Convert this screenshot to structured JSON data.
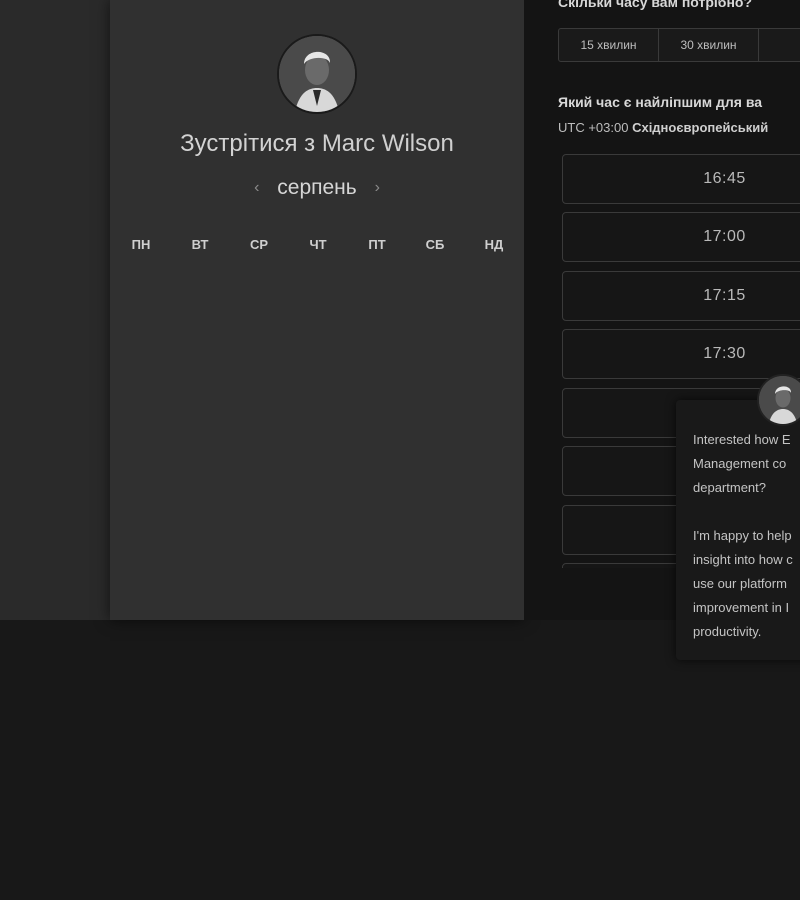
{
  "booking": {
    "title_prefix": "Зустрітися з",
    "host_name": "Marc Wilson",
    "month": "серпень",
    "prev_icon": "‹",
    "next_icon": "›",
    "weekdays": [
      "ПН",
      "ВТ",
      "СР",
      "ЧТ",
      "ПТ",
      "СБ",
      "НД"
    ]
  },
  "scheduler": {
    "duration_question": "Скільки часу вам потрібно?",
    "durations": [
      "15 хвилин",
      "30 хвилин",
      ""
    ],
    "time_question": "Який час є найліпшим для ва",
    "timezone_offset": "UTC +03:00",
    "timezone_name": "Східноєвропейський",
    "slots": [
      "16:45",
      "17:00",
      "17:15",
      "17:30",
      "",
      "",
      "",
      ""
    ]
  },
  "chat": {
    "message": "Interested how E\nManagement co\ndepartment?\n\nI'm happy to help\ninsight into how c\nuse our platform\nimprovement in I\nproductivity."
  }
}
